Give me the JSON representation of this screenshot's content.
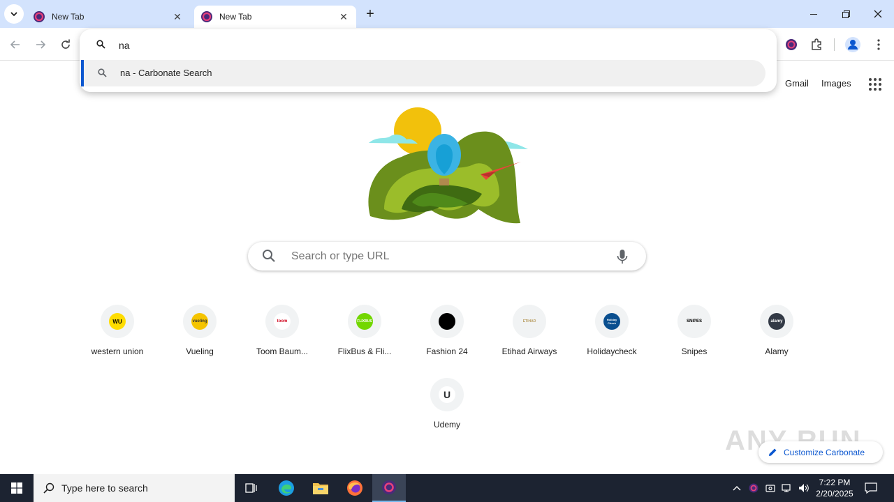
{
  "browser": {
    "tabs": [
      {
        "title": "New Tab",
        "active": false
      },
      {
        "title": "New Tab",
        "active": true
      }
    ],
    "accent": "#0b57d0",
    "tabstrip_color": "#d3e3fd"
  },
  "omnibox": {
    "value": "na",
    "suggestions": [
      {
        "text": "na - Carbonate Search",
        "icon": "search-icon"
      }
    ]
  },
  "toplinks": {
    "gmail": "Gmail",
    "images": "Images"
  },
  "search": {
    "placeholder": "Search or type URL"
  },
  "shortcuts": [
    {
      "label": "western union",
      "logo_text": "WU",
      "color": "#ffdd00"
    },
    {
      "label": "Vueling",
      "logo_text": "vueling",
      "color": "#f5c400"
    },
    {
      "label": "Toom Baum...",
      "logo_text": "toom",
      "color": "#ffffff"
    },
    {
      "label": "FlixBus & Fli...",
      "logo_text": "FLIXBUS",
      "color": "#73d700"
    },
    {
      "label": "Fashion 24",
      "logo_text": "",
      "color": "#000000"
    },
    {
      "label": "Etihad Airways",
      "logo_text": "ETIHAD",
      "color": "#f1f3f4"
    },
    {
      "label": "Holidaycheck",
      "logo_text": "Holiday Check",
      "color": "#0a4f8f"
    },
    {
      "label": "Snipes",
      "logo_text": "SNIPES",
      "color": "#f1f3f4"
    },
    {
      "label": "Alamy",
      "logo_text": "alamy",
      "color": "#333a46"
    },
    {
      "label": "Udemy",
      "logo_text": "U",
      "color": "#ffffff"
    }
  ],
  "customize": {
    "label": "Customize Carbonate"
  },
  "watermark": "ANY RUN",
  "taskbar": {
    "search_placeholder": "Type here to search",
    "time": "7:22 PM",
    "date": "2/20/2025"
  }
}
